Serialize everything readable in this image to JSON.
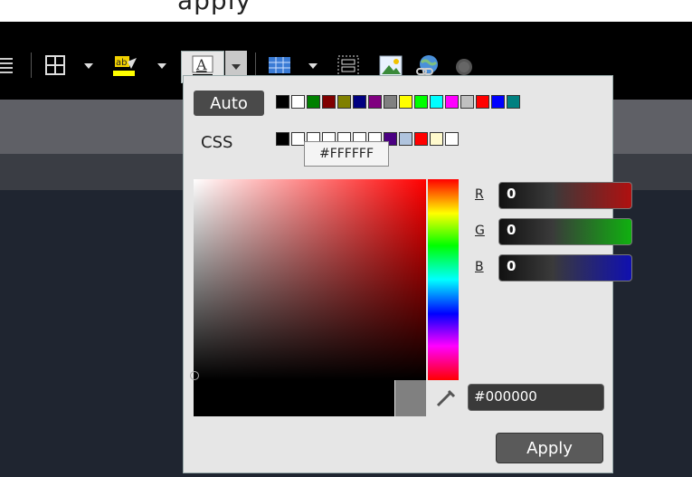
{
  "top_strip": {
    "partial_text": "apply"
  },
  "toolbar": {
    "icons": [
      "align-justify-icon",
      "table-icon",
      "highlight-color-icon",
      "font-color-icon",
      "insert-table-icon",
      "form-icon",
      "image-icon",
      "link-icon",
      "disabled-icon"
    ]
  },
  "color_picker": {
    "auto_label": "Auto",
    "css_label": "CSS",
    "tooltip": "#FFFFFF",
    "standard_colors": [
      "#000000",
      "#ffffff",
      "#008000",
      "#800000",
      "#808000",
      "#000080",
      "#800080",
      "#808080",
      "#ffff00",
      "#00ff00",
      "#00ffff",
      "#ff00ff",
      "#c0c0c0",
      "#ff0000",
      "#0000ff",
      "#008080"
    ],
    "css_colors": [
      "#000000",
      "#ffffff",
      "#ffffff",
      "#ffffff",
      "#ffffff",
      "#ffffff",
      "#ffffff",
      "#4b0082",
      "#b0c4de",
      "#ff0000",
      "#fffacd",
      "#ffffff"
    ],
    "r_label": "R",
    "g_label": "G",
    "b_label": "B",
    "r_value": "0",
    "g_value": "0",
    "b_value": "0",
    "hex_value": "#000000",
    "apply_label": "Apply",
    "current_color": "#000000",
    "previous_color": "#808080"
  }
}
